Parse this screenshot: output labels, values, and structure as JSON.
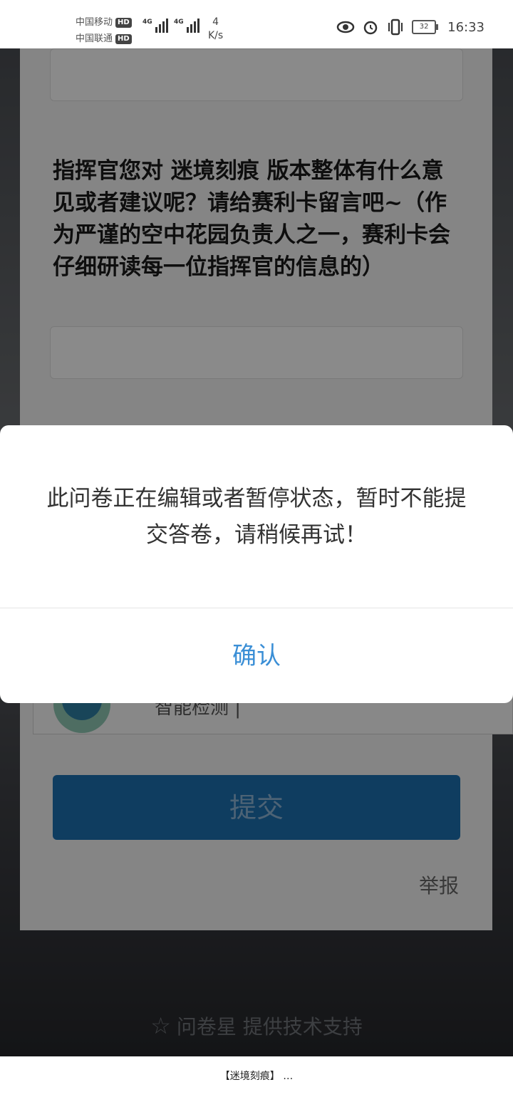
{
  "status_bar": {
    "carrier1": "中国移动",
    "carrier2": "中国联通",
    "hd": "HD",
    "network1": "4G",
    "network2": "4G",
    "speed_value": "4",
    "speed_unit": "K/s",
    "battery": "32",
    "time": "16:33"
  },
  "form": {
    "question": "指挥官您对 迷境刻痕 版本整体有什么意见或者建议呢？请给赛利卡留言吧~（作为严谨的空中花园负责人之一，赛利卡会仔细研读每一位指挥官的信息的）",
    "option_partial_text": "智能检测 |",
    "submit_label": "提交",
    "report_label": "举报"
  },
  "footer": {
    "text": "问卷星 提供技术支持"
  },
  "dialog": {
    "message": "此问卷正在编辑或者暂停状态，暂时不能提交答卷，请稍候再试！",
    "confirm_label": "确认"
  },
  "nav": {
    "title": "【迷境刻痕】 …"
  }
}
